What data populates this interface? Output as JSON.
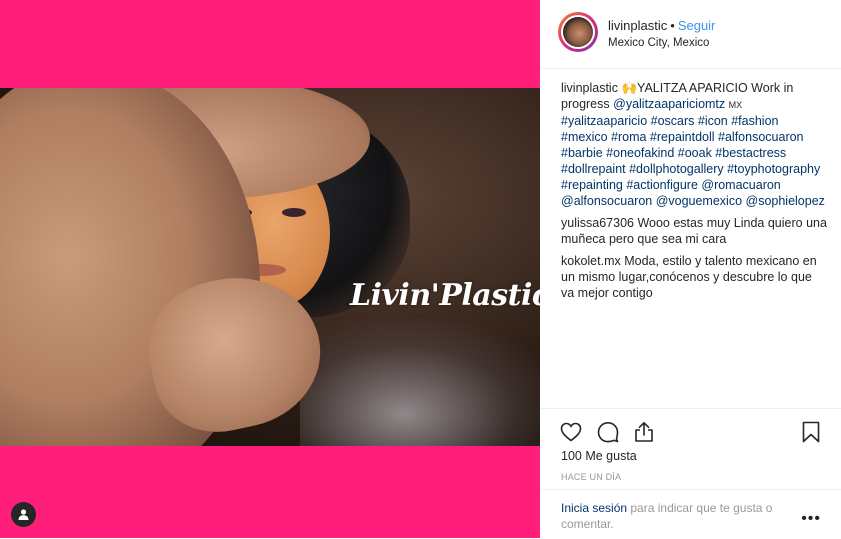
{
  "colors": {
    "media_background": "#ff1f7a",
    "link": "#003569",
    "follow": "#3897f0",
    "muted": "#999999",
    "text": "#262626"
  },
  "media": {
    "logo_text": "Livin'Plastic",
    "tag_icon": "user-icon"
  },
  "header": {
    "username": "livinplastic",
    "separator": "•",
    "follow_label": "Seguir",
    "location": "Mexico City, Mexico"
  },
  "caption": {
    "username": "livinplastic",
    "emoji": "🙌",
    "text": "YALITZA APARICIO Work in progress",
    "mention": "@yalitzaapariciomtz",
    "flag": "MX",
    "hashtags": "#yalitzaaparicio #oscars #icon #fashion #mexico #roma #repaintdoll #alfonsocuaron #barbie #oneofakind #ooak #bestactress #dollrepaint #dollphotogallery #toyphotography #repainting #actionfigure @romacuaron @alfonsocuaron @voguemexico @sophielopez"
  },
  "comments": [
    {
      "username": "yulissa67306",
      "text": "Wooo estas muy Linda quiero una muñeca pero que sea mi cara"
    },
    {
      "username": "kokolet.mx",
      "text": "Moda, estilo y talento mexicano en un mismo lugar,conócenos y descubre lo que va mejor contigo"
    }
  ],
  "actions": {
    "like_icon": "heart-icon",
    "comment_icon": "comment-icon",
    "share_icon": "share-icon",
    "save_icon": "bookmark-icon"
  },
  "likes": "100 Me gusta",
  "timestamp": "HACE UN DÍA",
  "login_prompt": {
    "link": "Inicia sesión",
    "rest": " para indicar que te gusta o comentar.",
    "more_icon": "more-options-icon",
    "more_glyph": "•••"
  }
}
